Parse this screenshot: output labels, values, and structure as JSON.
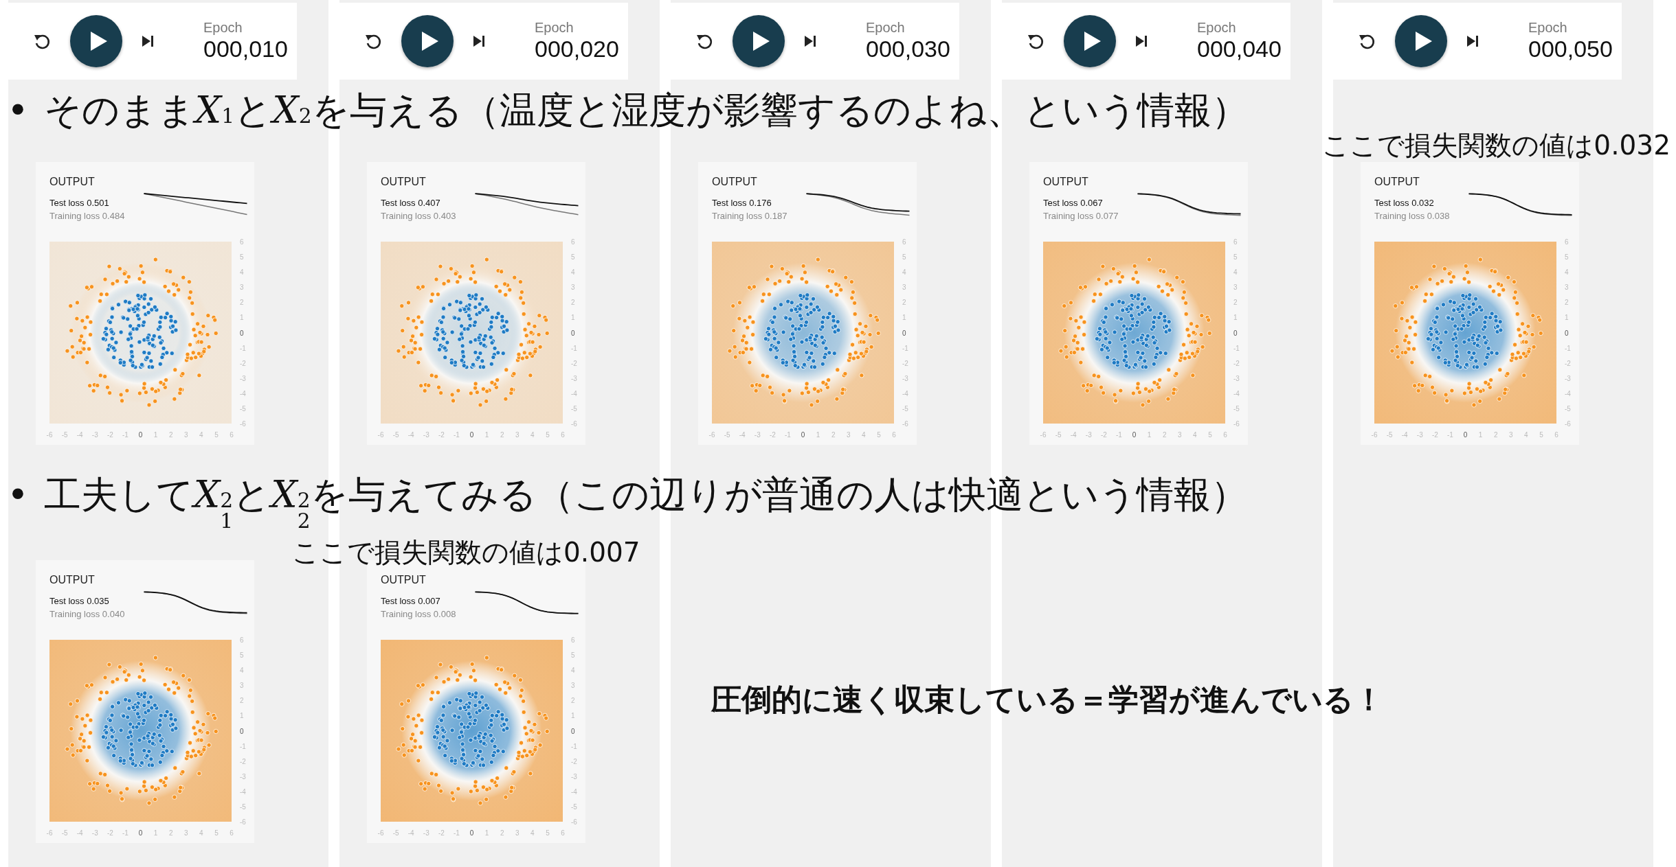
{
  "columns": [
    {
      "epoch_label": "Epoch",
      "epoch": "000,010"
    },
    {
      "epoch_label": "Epoch",
      "epoch": "000,020"
    },
    {
      "epoch_label": "Epoch",
      "epoch": "000,030"
    },
    {
      "epoch_label": "Epoch",
      "epoch": "000,040"
    },
    {
      "epoch_label": "Epoch",
      "epoch": "000,050"
    }
  ],
  "bullets": [
    {
      "marker": "•",
      "segments": [
        {
          "kind": "text",
          "text": "そのまま"
        },
        {
          "kind": "var",
          "text": "X",
          "sub": "1"
        },
        {
          "kind": "text",
          "text": "と"
        },
        {
          "kind": "var",
          "text": "X",
          "sub": "2"
        },
        {
          "kind": "text",
          "text": "を与える（温度と湿度が影響するのよね、という情報）"
        }
      ]
    },
    {
      "marker": "•",
      "segments": [
        {
          "kind": "text",
          "text": "工夫して"
        },
        {
          "kind": "var",
          "text": "X",
          "sub": "1",
          "sup": "2"
        },
        {
          "kind": "text",
          "text": "と"
        },
        {
          "kind": "var",
          "text": "X",
          "sub": "2",
          "sup": "2"
        },
        {
          "kind": "text",
          "text": "を与えてみる（この辺りが普通の人は快適という情報）"
        }
      ]
    }
  ],
  "outputs_top": [
    {
      "title": "OUTPUT",
      "test_loss": "Test loss 0.501",
      "training_loss": "Training loss 0.484",
      "y_ticks": [
        "6",
        "5",
        "4",
        "3",
        "2",
        "1",
        "0",
        "-1",
        "-2",
        "-3",
        "-4",
        "-5",
        "-6"
      ],
      "x_ticks": [
        "-6",
        "-5",
        "-4",
        "-3",
        "-2",
        "-1",
        "0",
        "1",
        "2",
        "3",
        "4",
        "5",
        "6"
      ]
    },
    {
      "title": "OUTPUT",
      "test_loss": "Test loss 0.407",
      "training_loss": "Training loss 0.403",
      "y_ticks": [
        "6",
        "5",
        "4",
        "3",
        "2",
        "1",
        "0",
        "-1",
        "-2",
        "-3",
        "-4",
        "-5",
        "-6"
      ],
      "x_ticks": [
        "-6",
        "-5",
        "-4",
        "-3",
        "-2",
        "-1",
        "0",
        "1",
        "2",
        "3",
        "4",
        "5",
        "6"
      ]
    },
    {
      "title": "OUTPUT",
      "test_loss": "Test loss 0.176",
      "training_loss": "Training loss 0.187",
      "y_ticks": [
        "6",
        "5",
        "4",
        "3",
        "2",
        "1",
        "0",
        "-1",
        "-2",
        "-3",
        "-4",
        "-5",
        "-6"
      ],
      "x_ticks": [
        "-6",
        "-5",
        "-4",
        "-3",
        "-2",
        "-1",
        "0",
        "1",
        "2",
        "3",
        "4",
        "5",
        "6"
      ]
    },
    {
      "title": "OUTPUT",
      "test_loss": "Test loss 0.067",
      "training_loss": "Training loss 0.077",
      "y_ticks": [
        "6",
        "5",
        "4",
        "3",
        "2",
        "1",
        "0",
        "-1",
        "-2",
        "-3",
        "-4",
        "-5",
        "-6"
      ],
      "x_ticks": [
        "-6",
        "-5",
        "-4",
        "-3",
        "-2",
        "-1",
        "0",
        "1",
        "2",
        "3",
        "4",
        "5",
        "6"
      ]
    },
    {
      "title": "OUTPUT",
      "test_loss": "Test loss 0.032",
      "training_loss": "Training loss 0.038",
      "y_ticks": [
        "6",
        "5",
        "4",
        "3",
        "2",
        "1",
        "0",
        "-1",
        "-2",
        "-3",
        "-4",
        "-5",
        "-6"
      ],
      "x_ticks": [
        "-6",
        "-5",
        "-4",
        "-3",
        "-2",
        "-1",
        "0",
        "1",
        "2",
        "3",
        "4",
        "5",
        "6"
      ]
    }
  ],
  "outputs_bottom": [
    {
      "title": "OUTPUT",
      "test_loss": "Test loss 0.035",
      "training_loss": "Training loss 0.040",
      "y_ticks": [
        "6",
        "5",
        "4",
        "3",
        "2",
        "1",
        "0",
        "-1",
        "-2",
        "-3",
        "-4",
        "-5",
        "-6"
      ],
      "x_ticks": [
        "-6",
        "-5",
        "-4",
        "-3",
        "-2",
        "-1",
        "0",
        "1",
        "2",
        "3",
        "4",
        "5",
        "6"
      ]
    },
    {
      "title": "OUTPUT",
      "test_loss": "Test loss 0.007",
      "training_loss": "Training loss 0.008",
      "y_ticks": [
        "6",
        "5",
        "4",
        "3",
        "2",
        "1",
        "0",
        "-1",
        "-2",
        "-3",
        "-4",
        "-5",
        "-6"
      ],
      "x_ticks": [
        "-6",
        "-5",
        "-4",
        "-3",
        "-2",
        "-1",
        "0",
        "1",
        "2",
        "3",
        "4",
        "5",
        "6"
      ]
    }
  ],
  "notes": [
    {
      "text": "ここで損失関数の値は0.032"
    },
    {
      "text": "ここで損失関数の値は0.007"
    }
  ],
  "conclusion": "圧倒的に速く収束している＝学習が進んでいる！"
}
